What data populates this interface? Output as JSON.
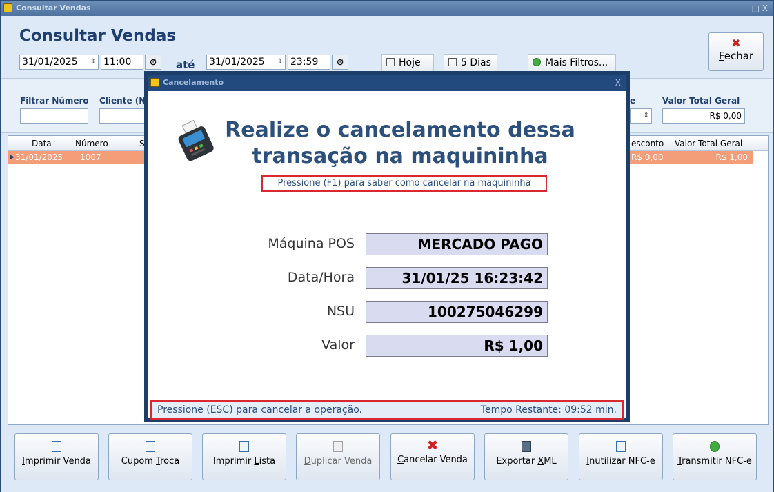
{
  "window": {
    "title": "Consultar Vendas",
    "controls": "□ X"
  },
  "page_title": "Consultar Vendas",
  "date_range": {
    "start_date": "31/01/2025",
    "start_time": "11:00",
    "separator": "até",
    "end_date": "31/01/2025",
    "end_time": "23:59"
  },
  "toolbar": {
    "today": "Hoje",
    "five_days": "5 Dias",
    "more_filters": "Mais Filtros..."
  },
  "close_button": {
    "prefix": "F",
    "rest": "echar"
  },
  "filters": {
    "number_label": "Filtrar Número",
    "client_label": "Cliente  (N",
    "partial_label": "e",
    "total_label": "Valor Total Geral",
    "total_value": "R$ 0,00"
  },
  "grid": {
    "headers": {
      "date": "Data",
      "number": "Número",
      "s": "S",
      "discount": "esconto",
      "total": "Valor Total Geral"
    },
    "rows": [
      {
        "date": "31/01/2025",
        "number": "1007",
        "discount": "R$ 0,00",
        "total": "R$ 1,00"
      }
    ]
  },
  "actions": [
    {
      "pre": "",
      "u": "I",
      "post": "mprimir Venda"
    },
    {
      "pre": "Cupom ",
      "u": "T",
      "post": "roca"
    },
    {
      "pre": "Imprimir ",
      "u": "L",
      "post": "ista"
    },
    {
      "pre": "",
      "u": "D",
      "post": "uplicar Venda"
    },
    {
      "pre": "",
      "u": "C",
      "post": "ancelar Venda"
    },
    {
      "pre": "Exportar ",
      "u": "X",
      "post": "ML"
    },
    {
      "pre": "",
      "u": "I",
      "post": "nutilizar NFC-e"
    },
    {
      "pre": "",
      "u": "T",
      "post": "ransmitir NFC-e"
    }
  ],
  "modal": {
    "title": "Cancelamento",
    "close": "X",
    "heading_line1": "Realize o cancelamento dessa",
    "heading_line2": "transação na maquininha",
    "hint": "Pressione (F1) para saber como cancelar na maquininha",
    "fields": {
      "machine_label": "Máquina POS",
      "machine_value": "MERCADO PAGO",
      "datetime_label": "Data/Hora",
      "datetime_value": "31/01/25 16:23:42",
      "nsu_label": "NSU",
      "nsu_value": "100275046299",
      "amount_label": "Valor",
      "amount_value": "R$ 1,00"
    },
    "footer_left": "Pressione (ESC) para cancelar a operação.",
    "footer_right": "Tempo Restante: 09:52 min."
  }
}
